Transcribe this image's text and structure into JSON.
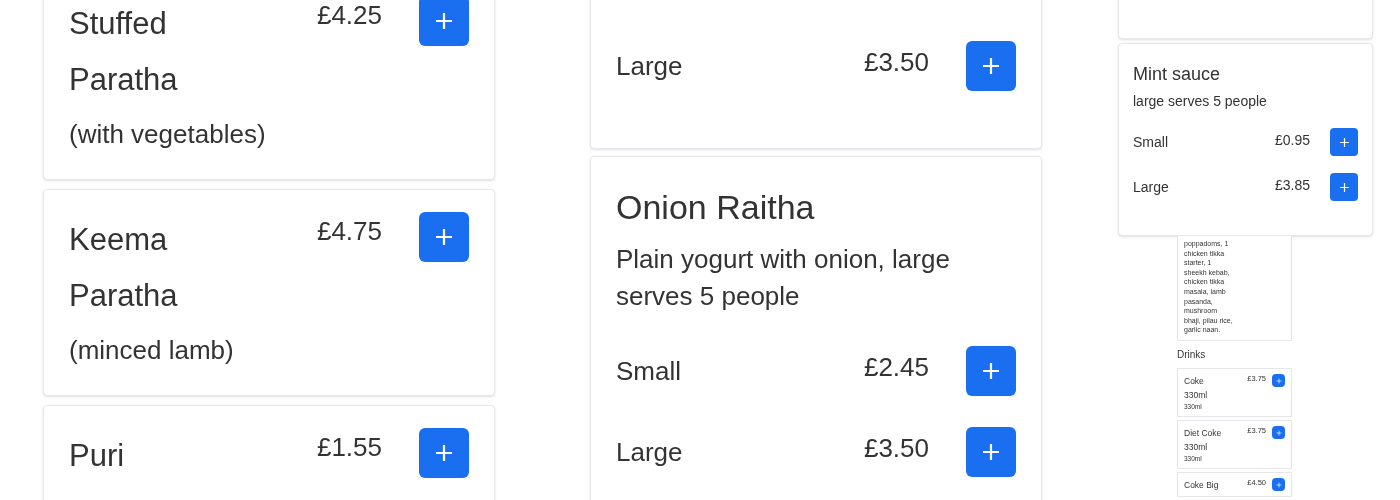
{
  "columns": [
    {
      "kind": "large",
      "items": [
        {
          "name": "Stuffed Paratha",
          "description": "(with vegetables)",
          "price": "£4.25"
        },
        {
          "name": "Keema Paratha",
          "description": "(minced lamb)",
          "price": "£4.75"
        },
        {
          "name": "Puri",
          "price": "£1.55"
        }
      ]
    },
    {
      "kind": "options",
      "items": [
        {
          "options": [
            {
              "label": "Large",
              "price": "£3.50"
            }
          ]
        },
        {
          "name": "Onion Raitha",
          "description": "Plain yogurt with onion, large serves 5 people",
          "options": [
            {
              "label": "Small",
              "price": "£2.45"
            },
            {
              "label": "Large",
              "price": "£3.50"
            }
          ]
        }
      ]
    },
    {
      "kind": "small",
      "items": [
        {
          "kind": "cut"
        },
        {
          "kind": "card",
          "name": "Mint sauce",
          "description": "large serves 5 people",
          "options": [
            {
              "label": "Small",
              "price": "£0.95"
            },
            {
              "label": "Large",
              "price": "£3.85"
            }
          ]
        }
      ],
      "tiny": {
        "set_menu_text": "poppadoms, 1 chicken tikka starter, 1 sheekh kebab, chicken tikka masala, lamb pasanda, mushroom bhaji, pilau rice, garlic naan.",
        "section_title": "Drinks",
        "items": [
          {
            "name": "Coke 330ml",
            "price": "£3.75",
            "description": "330ml"
          },
          {
            "name": "Diet Coke 330ml",
            "price": "£3.75",
            "description": "330ml"
          },
          {
            "name": "Coke Big",
            "price": "£4.50"
          }
        ]
      }
    }
  ]
}
